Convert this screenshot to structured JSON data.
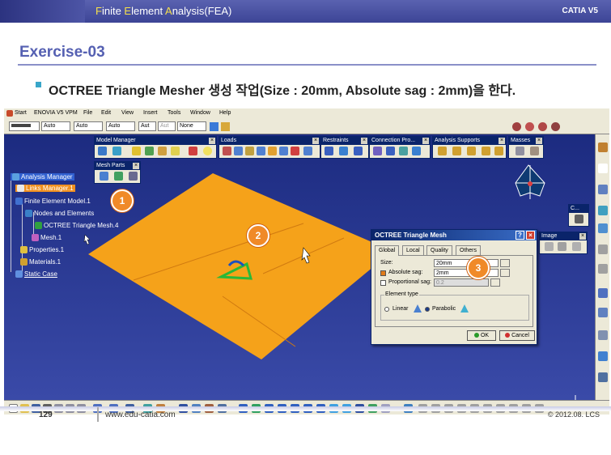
{
  "slide": {
    "header_title_parts": [
      "F",
      "inite ",
      "E",
      "lement ",
      "A",
      "nalysis(FEA)"
    ],
    "brand": "CATIA V5",
    "exercise_title": "Exercise-03",
    "task": "OCTREE Triangle Mesher 생성 작업(Size : 20mm, Absolute sag : 2mm)을 한다.",
    "page_number": "129",
    "url": "www.edu-catia.com",
    "copyright": "© 2012.08. LCS"
  },
  "menu": [
    "Start",
    "ENOVIA V5 VPM",
    "File",
    "Edit",
    "View",
    "Insert",
    "Tools",
    "Window",
    "Help"
  ],
  "props": [
    "Auto",
    "Auto",
    "Auto",
    "Aut",
    "Aut",
    "None"
  ],
  "toolbars": {
    "model_manager": "Model Manager",
    "loads": "Loads",
    "restraints": "Restraints",
    "connection": "Connection Pro...",
    "analysis_supports": "Analysis Supports",
    "masses": "Masses",
    "mesh_parts": "Mesh Parts",
    "image": "Image",
    "c_toolbar": "C..."
  },
  "tree": {
    "analysis_manager": "Analysis Manager",
    "links_manager": "Links Manager.1",
    "fem": "Finite Element Model.1",
    "nodes": "Nodes and Elements",
    "octree": "OCTREE Triangle Mesh.4",
    "mesh": "Mesh.1",
    "properties": "Properties.1",
    "materials": "Materials.1",
    "static_case": "Static Case"
  },
  "dialog": {
    "title": "OCTREE Triangle Mesh",
    "tabs": [
      "Global",
      "Local",
      "Quality",
      "Others"
    ],
    "size_label": "Size:",
    "size_value": "20mm",
    "abs_sag_label": "Absolute sag:",
    "abs_sag_value": "2mm",
    "prop_sag_label": "Proportional sag:",
    "prop_sag_value": "0.2",
    "element_type_label": "Element type",
    "linear_label": "Linear",
    "parabolic_label": "Parabolic",
    "ok": "OK",
    "cancel": "Cancel"
  },
  "badges": [
    "1",
    "2",
    "3"
  ],
  "colors": {
    "accent": "#5560b2",
    "viewport": "#1f2f88",
    "plate": "#f5a21a",
    "badge": "#f08a28"
  }
}
